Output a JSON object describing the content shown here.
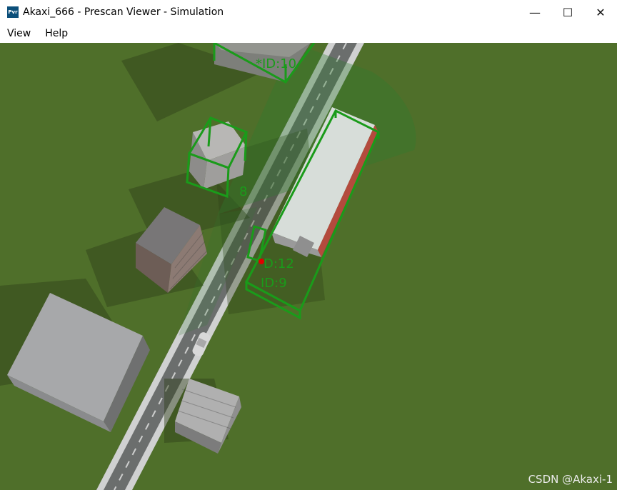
{
  "window": {
    "title": "Akaxi_666 - Prescan Viewer - Simulation",
    "icon_text": "Pvr",
    "controls": [
      "minimize",
      "maximize",
      "close"
    ]
  },
  "menu": {
    "items": [
      {
        "label": "View"
      },
      {
        "label": "Help"
      }
    ]
  },
  "scene": {
    "labels": [
      {
        "text": "*ID:10"
      },
      {
        "text": "8"
      },
      {
        "text": "D:12"
      },
      {
        "text": "ID:9"
      }
    ]
  },
  "watermark": "CSDN @Akaxi-1",
  "colors": {
    "grass": "#4f6f2a",
    "bbox": "#1a9b1a",
    "road": "#6b6e6d",
    "sensor_fov": "#2f7a2f"
  }
}
